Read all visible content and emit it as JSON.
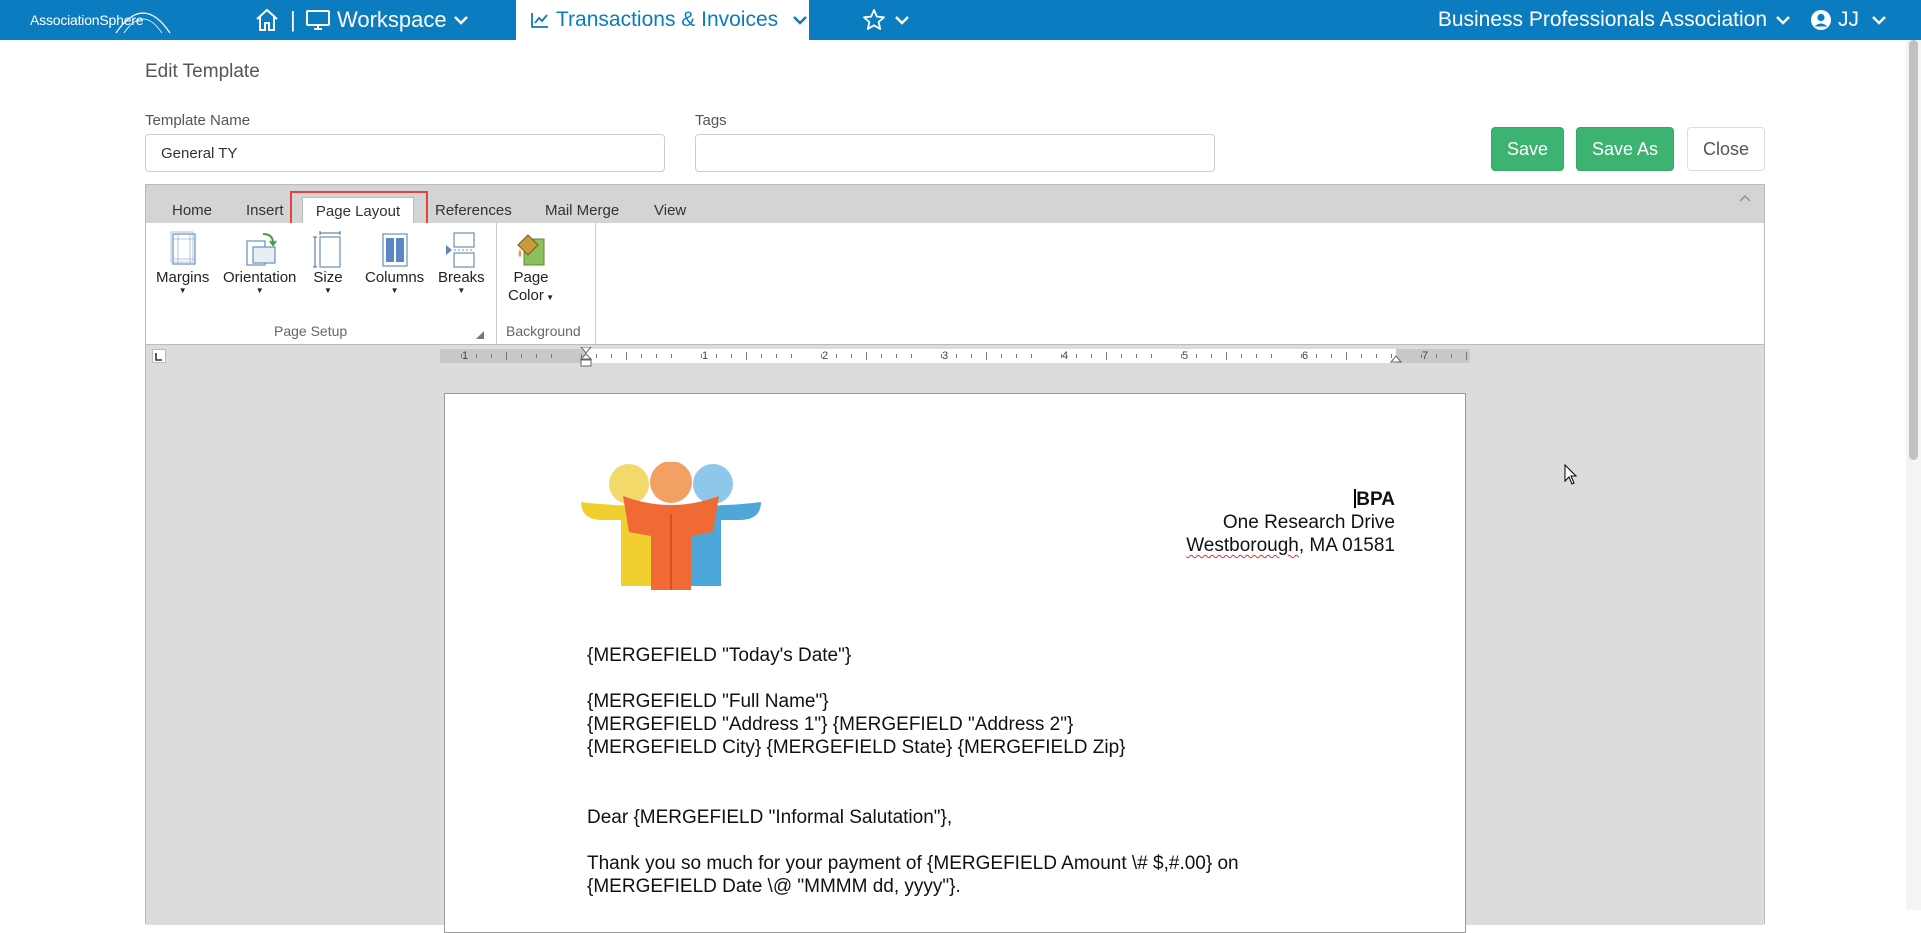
{
  "topbar": {
    "logo_text": "AssociationSphere",
    "separator": "|",
    "workspace": "Workspace",
    "transactions": "Transactions & Invoices",
    "organization": "Business Professionals Association",
    "user_initials": "JJ",
    "colors": {
      "bar": "#0b7cbf",
      "active_tab_text": "#0b7cbf"
    }
  },
  "form": {
    "title": "Edit Template",
    "template_name_label": "Template Name",
    "template_name_value": "General TY",
    "tags_label": "Tags",
    "tags_value": "",
    "save": "Save",
    "save_as": "Save As",
    "close": "Close",
    "button_color": "#3cb371"
  },
  "ribbon": {
    "tabs": [
      "Home",
      "Insert",
      "Page Layout",
      "References",
      "Mail Merge",
      "View"
    ],
    "active_tab": "Page Layout",
    "page_setup": {
      "buttons": [
        "Margins",
        "Orientation",
        "Size",
        "Columns",
        "Breaks"
      ],
      "group_label": "Page Setup"
    },
    "background": {
      "button_line1": "Page",
      "button_line2": "Color",
      "group_label": "Background"
    }
  },
  "ruler": {
    "labels": [
      "1",
      "1",
      "2",
      "3",
      "4",
      "5",
      "6",
      "7"
    ]
  },
  "document": {
    "address": {
      "org": "BPA",
      "street": "One Research Drive",
      "city_word": "Westborough",
      "city_rest": ", MA 01581"
    },
    "lines": [
      "{MERGEFIELD \"Today's Date\"}",
      "{MERGEFIELD \"Full Name\"}",
      "{MERGEFIELD \"Address 1\"} {MERGEFIELD \"Address 2\"}",
      "{MERGEFIELD City} {MERGEFIELD State} {MERGEFIELD Zip}",
      "Dear {MERGEFIELD \"Informal Salutation\"},",
      "Thank you so much for your payment of {MERGEFIELD Amount \\# $,#.00} on",
      "{MERGEFIELD Date \\@ \"MMMM dd, yyyy\"}."
    ]
  }
}
